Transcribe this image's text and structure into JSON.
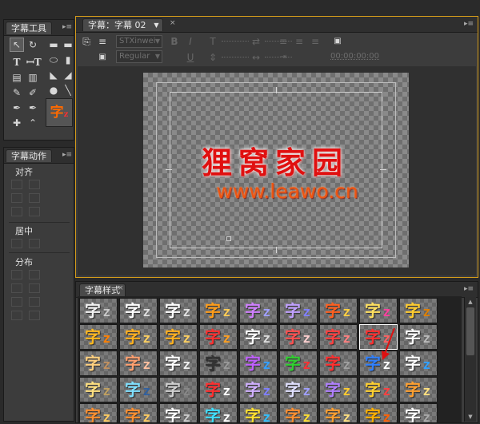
{
  "tools_panel": {
    "title": "字幕工具"
  },
  "title_window": {
    "tab_label": "字幕：字幕 02",
    "font_name": "STXinwei",
    "font_style": "Regular",
    "timecode": "00:00:00:00",
    "canvas_text_1": "狸窝家园",
    "canvas_text_2": "www.leawo.cn",
    "canvas_text_1_color": "#e01010",
    "canvas_text_2_color": "#ee5511"
  },
  "actions_panel": {
    "title": "字幕动作",
    "align_label": "对齐",
    "center_label": "居中",
    "distribute_label": "分布"
  },
  "styles_panel": {
    "title": "字幕样式",
    "glyph": "字",
    "rows": [
      [
        {
          "a": "#f2f2f2",
          "b": "#c8c8c8"
        },
        {
          "a": "#ffffff",
          "b": "#dddddd"
        },
        {
          "a": "#ffffff",
          "b": "#e0e0e0"
        },
        {
          "a": "#ff9d1a",
          "b": "#ffcc55"
        },
        {
          "a": "#d080ff",
          "b": "#a0a0ff"
        },
        {
          "a": "#c0a0ff",
          "b": "#8080ff"
        },
        {
          "a": "#ff6020",
          "b": "#ffd040"
        },
        {
          "a": "#ffe060",
          "b": "#ff40a0"
        },
        {
          "a": "#ffcc30",
          "b": "#e08000"
        }
      ],
      [
        {
          "a": "#ffb820",
          "b": "#ff8000"
        },
        {
          "a": "#ffb020",
          "b": "#ffd060"
        },
        {
          "a": "#ffb020",
          "b": "#ffd060"
        },
        {
          "a": "#ff3030",
          "b": "#ffa020"
        },
        {
          "a": "#ffffff",
          "b": "#dddddd"
        },
        {
          "a": "#ff5050",
          "b": "#ffd0d0"
        },
        {
          "a": "#ff4040",
          "b": "#ff8080"
        },
        {
          "a": "#ff3030",
          "b": "#ff6060"
        },
        {
          "a": "#ffffff",
          "b": "#bbbbbb"
        }
      ],
      [
        {
          "a": "#ffd080",
          "b": "#c09060"
        },
        {
          "a": "#ffa070",
          "b": "#ffc0a0"
        },
        {
          "a": "#ffffff",
          "b": "#eeeeee"
        },
        {
          "a": "#333333",
          "b": "#999999"
        },
        {
          "a": "#c060ff",
          "b": "#30a0ff"
        },
        {
          "a": "#30d030",
          "b": "#ff3030"
        },
        {
          "a": "#ff3030",
          "b": "#a0a0a0"
        },
        {
          "a": "#3080ff",
          "b": "#ffffff"
        },
        {
          "a": "#ffffff",
          "b": "#30a0ff"
        }
      ],
      [
        {
          "a": "#ffe080",
          "b": "#c0a060"
        },
        {
          "a": "#80e0ff",
          "b": "#3060a0"
        },
        {
          "a": "#d0d0d0",
          "b": "#888888"
        },
        {
          "a": "#ff3030",
          "b": "#ffffff"
        },
        {
          "a": "#d0b0ff",
          "b": "#8080ff"
        },
        {
          "a": "#e0e0ff",
          "b": "#a0a0ff"
        },
        {
          "a": "#b080ff",
          "b": "#ffcc30"
        },
        {
          "a": "#ffd030",
          "b": "#ff4040"
        },
        {
          "a": "#ffa030",
          "b": "#ffe080"
        }
      ],
      [
        {
          "a": "#ff9030",
          "b": "#ffcc60"
        },
        {
          "a": "#ff9030",
          "b": "#ffcc60"
        },
        {
          "a": "#ffffff",
          "b": "#cccccc"
        },
        {
          "a": "#40e0ff",
          "b": "#ffffff"
        },
        {
          "a": "#ffe030",
          "b": "#30c0ff"
        },
        {
          "a": "#ff9030",
          "b": "#ffe030"
        },
        {
          "a": "#ffa030",
          "b": "#ffe080"
        },
        {
          "a": "#ffb000",
          "b": "#ff6000"
        },
        {
          "a": "#ffffff",
          "b": "#aaaaaa"
        }
      ]
    ]
  }
}
